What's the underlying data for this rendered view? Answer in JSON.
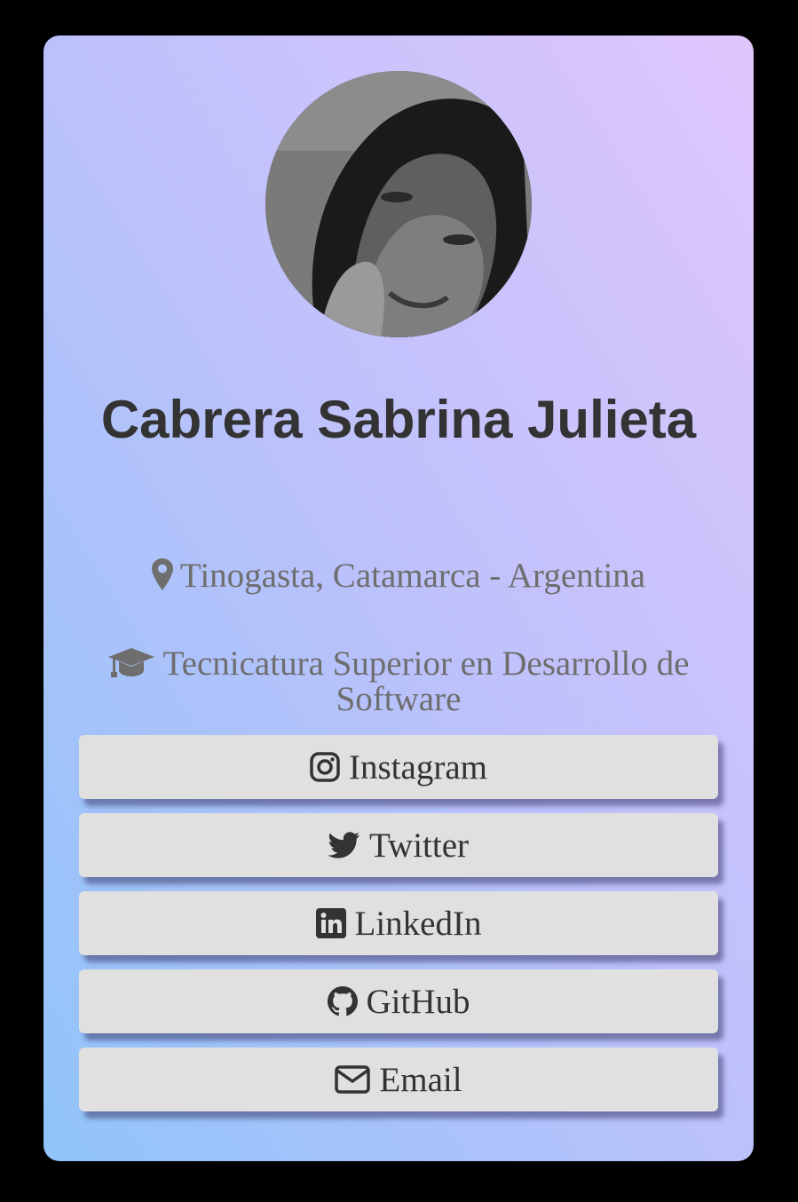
{
  "profile": {
    "name": "Cabrera Sabrina Julieta",
    "location": "Tinogasta, Catamarca - Argentina",
    "education": "Tecnicatura Superior en Desarrollo de Software"
  },
  "links": [
    {
      "label": "Instagram",
      "icon": "instagram-icon"
    },
    {
      "label": "Twitter",
      "icon": "twitter-icon"
    },
    {
      "label": "LinkedIn",
      "icon": "linkedin-icon"
    },
    {
      "label": "GitHub",
      "icon": "github-icon"
    },
    {
      "label": "Email",
      "icon": "envelope-icon"
    }
  ],
  "colors": {
    "page_background": "#000000",
    "gradient_start": "#90c4fa",
    "gradient_end": "#e0c6fd",
    "button_background": "#e0e0e0",
    "name_text": "#333333",
    "secondary_text": "#6e6e6e"
  }
}
